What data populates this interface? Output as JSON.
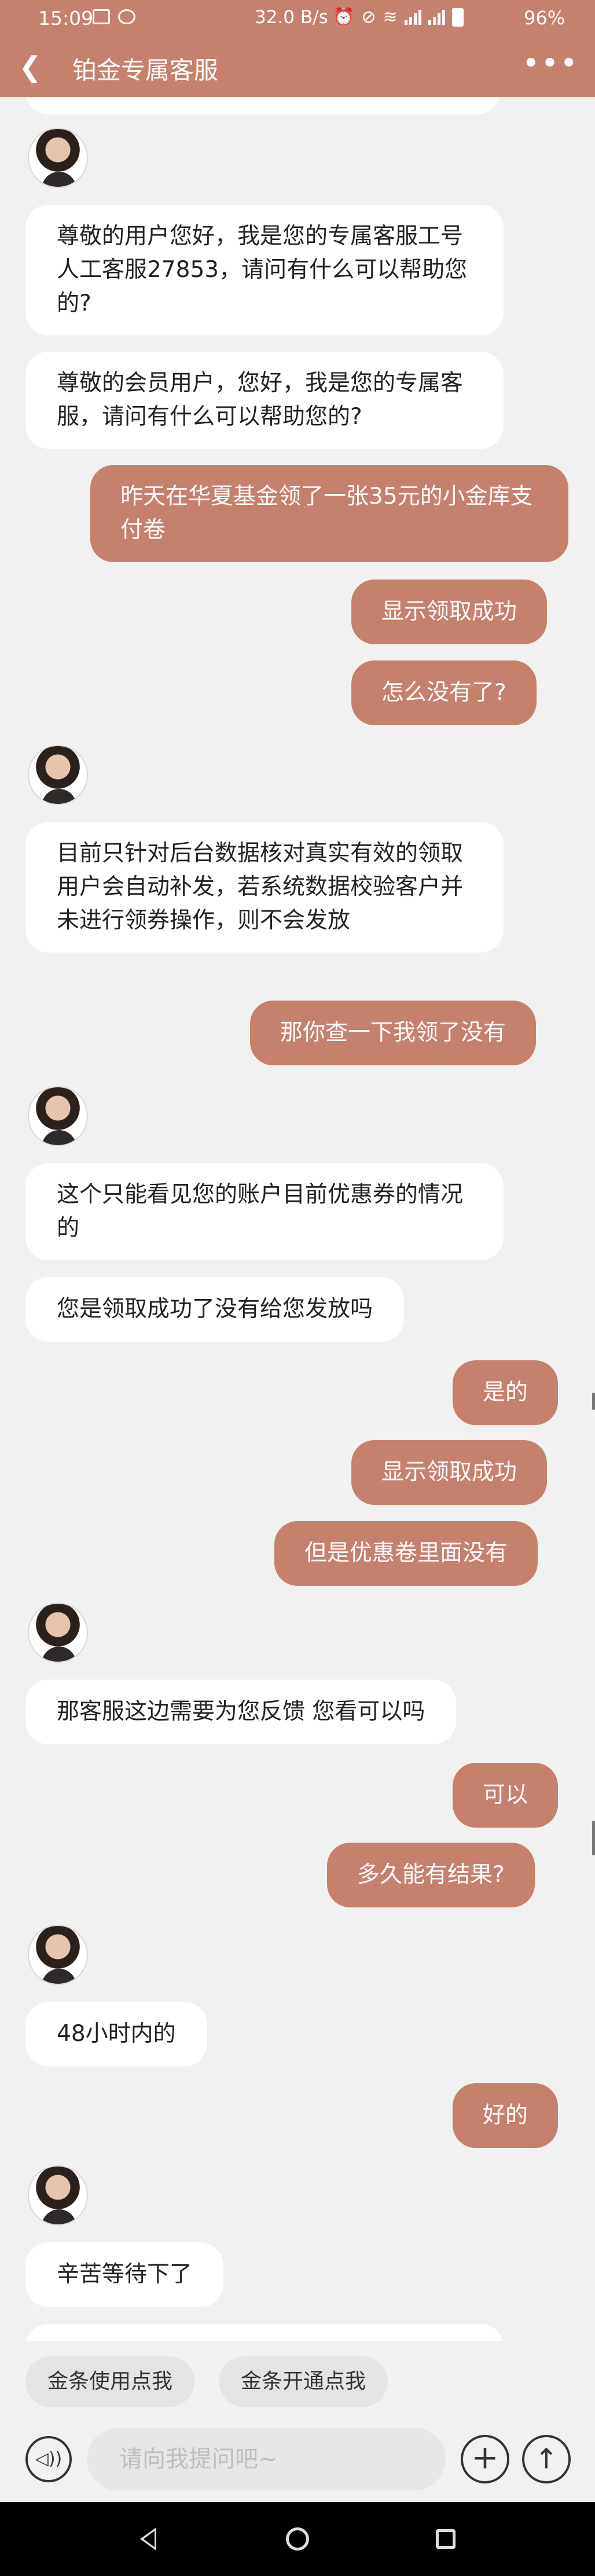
{
  "status_bar": {
    "time": "15:09",
    "network_speed": "32.0 B/s",
    "battery": "96%",
    "icons": [
      "image-icon",
      "app-icon",
      "alarm-icon",
      "dnd-icon",
      "wifi-icon",
      "signal-4g-icon",
      "signal-4g-2-icon",
      "battery-icon"
    ]
  },
  "header": {
    "title": "铂金专属客服",
    "back_icon": "chevron-left-icon",
    "more_icon": "more-dots-icon",
    "more_glyph": "•••"
  },
  "messages": [
    {
      "from": "agent",
      "avatar": true,
      "text": "尊敬的用户您好，我是您的专属客服工号人工客服27853，请问有什么可以帮助您的?"
    },
    {
      "from": "agent",
      "text": "尊敬的会员用户，您好，我是您的专属客服，请问有什么可以帮助您的?"
    },
    {
      "from": "user",
      "text": "昨天在华夏基金领了一张35元的小金库支付卷"
    },
    {
      "from": "user",
      "text": "显示领取成功"
    },
    {
      "from": "user",
      "text": "怎么没有了?"
    },
    {
      "from": "agent",
      "avatar": true,
      "text": "目前只针对后台数据核对真实有效的领取用户会自动补发，若系统数据校验客户并未进行领券操作，则不会发放"
    },
    {
      "from": "user",
      "text": "那你查一下我领了没有"
    },
    {
      "from": "agent",
      "avatar": true,
      "text": "这个只能看见您的账户目前优惠券的情况的"
    },
    {
      "from": "agent",
      "text": "您是领取成功了没有给您发放吗"
    },
    {
      "from": "user",
      "text": "是的"
    },
    {
      "from": "user",
      "text": "显示领取成功"
    },
    {
      "from": "user",
      "text": "但是优惠卷里面没有"
    },
    {
      "from": "agent",
      "avatar": true,
      "text": "那客服这边需要为您反馈 您看可以吗"
    },
    {
      "from": "user",
      "text": "可以"
    },
    {
      "from": "user",
      "text": "多久能有结果?"
    },
    {
      "from": "agent",
      "avatar": true,
      "text": "48小时内的"
    },
    {
      "from": "user",
      "text": "好的"
    },
    {
      "from": "agent",
      "avatar": true,
      "text": "辛苦等待下了"
    }
  ],
  "quick_replies": [
    "金条使用点我",
    "金条开通点我"
  ],
  "composer": {
    "placeholder": "请向我提问吧~",
    "voice_icon": "voice-icon",
    "plus_icon": "plus-icon",
    "send_icon": "send-arrow-icon",
    "voice_glyph": "◁))",
    "plus_glyph": "+",
    "send_glyph": "↑"
  },
  "nav_bar": {
    "icons": [
      "back-triangle-icon",
      "home-circle-icon",
      "recents-square-icon"
    ]
  },
  "colors": {
    "accent": "#c6816d",
    "agent_bubble": "#ffffff",
    "background": "#f1f1f1"
  }
}
